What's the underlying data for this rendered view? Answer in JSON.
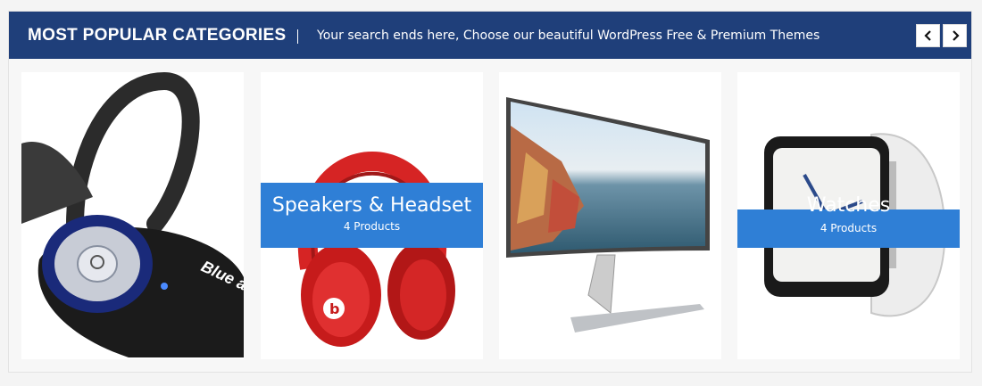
{
  "header": {
    "title": "MOST POPULAR CATEGORIES",
    "subtitle": "Your search ends here, Choose our beautiful WordPress Free & Premium Themes",
    "bg_color": "#1f3f7a"
  },
  "nav": {
    "prev_icon": "chevron-left-icon",
    "next_icon": "chevron-right-icon"
  },
  "categories": [
    {
      "image": "bluetooth-headset"
    },
    {
      "image": "red-headphones",
      "name": "Speakers & Headset",
      "count": "4 Products"
    },
    {
      "image": "curved-monitor"
    },
    {
      "image": "smart-watch",
      "name": "Watches",
      "count": "4 Products"
    }
  ],
  "overlay_color": "#2f7fd6",
  "image_text": {
    "brand": "Blue ant"
  }
}
